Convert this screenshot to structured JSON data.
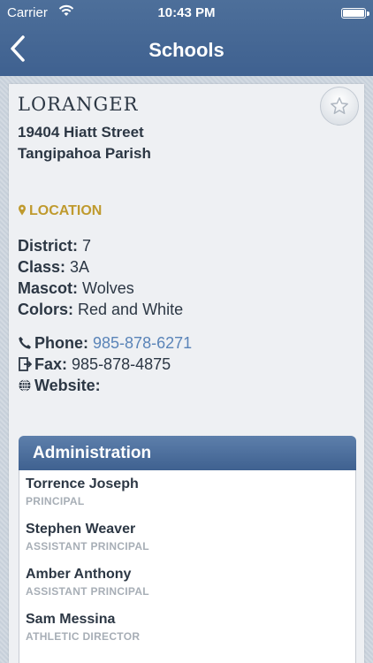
{
  "status_bar": {
    "carrier": "Carrier",
    "time": "10:43 PM"
  },
  "nav": {
    "title": "Schools"
  },
  "school": {
    "name": "LORANGER",
    "address_line1": "19404 Hiatt Street",
    "address_line2": "Tangipahoa Parish"
  },
  "location": {
    "label": "LOCATION"
  },
  "details": {
    "district_label": "District:",
    "district_value": "7",
    "class_label": "Class:",
    "class_value": "3A",
    "mascot_label": "Mascot:",
    "mascot_value": "Wolves",
    "colors_label": "Colors:",
    "colors_value": "Red and White"
  },
  "contact": {
    "phone_label": "Phone:",
    "phone_value": "985-878-6271",
    "fax_label": "Fax:",
    "fax_value": "985-878-4875",
    "website_label": "Website:"
  },
  "administration": {
    "title": "Administration",
    "people": [
      {
        "name": "Torrence Joseph",
        "role": "PRINCIPAL"
      },
      {
        "name": "Stephen Weaver",
        "role": "ASSISTANT PRINCIPAL"
      },
      {
        "name": "Amber Anthony",
        "role": "ASSISTANT PRINCIPAL"
      },
      {
        "name": "Sam Messina",
        "role": "ATHLETIC DIRECTOR"
      }
    ]
  },
  "colors": {
    "nav_bar": "#3f6190",
    "accent_gold": "#bf9a2e",
    "link_blue": "#5a84b8"
  }
}
